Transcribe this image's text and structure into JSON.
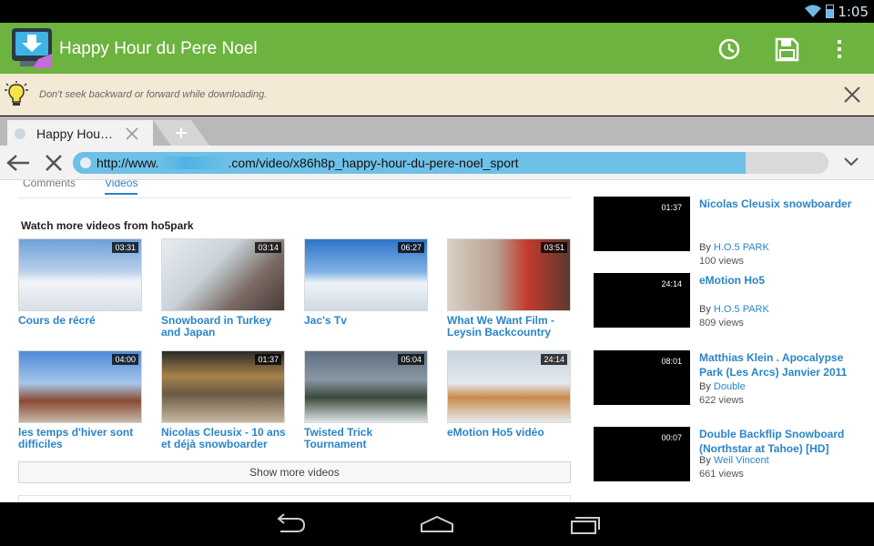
{
  "status": {
    "time": "1:05"
  },
  "app": {
    "title": "Happy Hour du Pere Noel"
  },
  "notice": {
    "text": "Don't seek backward or forward while downloading."
  },
  "tab": {
    "label": "Happy Hou…"
  },
  "url": {
    "prefix": "http://www.",
    "suffix": ".com/video/x86h8p_happy-hour-du-pere-noel_sport",
    "progress_percent": 89
  },
  "page": {
    "subtabs": [
      "Comments",
      "Videos"
    ],
    "section_heading": "Watch more videos from ho5park",
    "grid": [
      {
        "title": "Cours de récré",
        "duration": "03:31"
      },
      {
        "title": "Snowboard in Turkey and Japan",
        "duration": "03:14"
      },
      {
        "title": "Jac's Tv",
        "duration": "06:27"
      },
      {
        "title": "What We Want Film - Leysin Backcountry",
        "duration": "03:51"
      },
      {
        "title": "les temps d'hiver sont difficiles",
        "duration": "04:00"
      },
      {
        "title": "Nicolas Cleusix - 10 ans et déjà snowboarder",
        "duration": "01:37"
      },
      {
        "title": "Twisted Trick Tournament",
        "duration": "05:04"
      },
      {
        "title": "eMotion Ho5 vidéo",
        "duration": "24:14"
      }
    ],
    "show_more": "Show more videos",
    "sidebar": [
      {
        "title": "Nicolas Cleusix snowboarder",
        "duration": "01:37",
        "by": "By",
        "channel": "H.O.5 PARK",
        "views": "100 views"
      },
      {
        "title": "eMotion Ho5",
        "duration": "24:14",
        "by": "By",
        "channel": "H.O.5 PARK",
        "views": "809 views"
      },
      {
        "title": "Matthias Klein . Apocalypse Park (Les Arcs) Janvier 2011",
        "duration": "08:01",
        "by": "By",
        "channel": "Double",
        "views": "622 views"
      },
      {
        "title": "Double Backflip Snowboard (Northstar at Tahoe) [HD]",
        "duration": "00:07",
        "by": "By",
        "channel": "Weil Vincent",
        "views": "661 views"
      }
    ]
  },
  "colors": {
    "action_bar": "#6cb33f",
    "link": "#2a84c8",
    "url_progress": "#6ec0e6",
    "notice_bg": "#f3e9d4"
  },
  "icons": {
    "app": "download-tv-icon",
    "history": "clock-icon",
    "save": "floppy-disk-icon",
    "overflow": "overflow-menu-icon",
    "notice": "lightbulb-icon",
    "close": "close-icon",
    "back": "back-arrow-icon",
    "stop": "stop-icon",
    "menu": "chevron-down-icon",
    "nav_back": "nav-back-icon",
    "nav_home": "nav-home-icon",
    "nav_recents": "nav-recents-icon"
  }
}
